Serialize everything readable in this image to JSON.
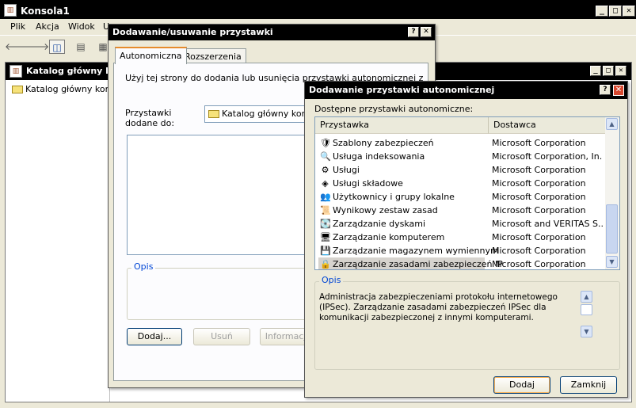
{
  "mmc": {
    "title": "Konsola1",
    "menu": [
      "Plik",
      "Akcja",
      "Widok",
      "U"
    ],
    "child_title": "Katalog główny kor",
    "tree_root": "Katalog główny kons"
  },
  "dialog1": {
    "title": "Dodawanie/usuwanie przystawki",
    "tabs": [
      "Autonomiczna",
      "Rozszerzenia"
    ],
    "intro": "Użyj tej strony do dodania lub usunięcia przystawki autonomicznej z konsoli.",
    "added_to_label": "Przystawki dodane do:",
    "added_to_value": "Katalog główny konso",
    "description_label": "Opis",
    "buttons": {
      "add": "Dodaj...",
      "remove": "Usuń",
      "about": "Informacje"
    }
  },
  "dialog2": {
    "title": "Dodawanie przystawki autonomicznej",
    "list_label": "Dostępne przystawki autonomiczne:",
    "columns": {
      "snapin": "Przystawka",
      "vendor": "Dostawca"
    },
    "rows": [
      {
        "name": "Szablony zabezpieczeń",
        "vendor": "Microsoft Corporation",
        "icon": "security-template-icon",
        "glyph": "🛡",
        "selected": false
      },
      {
        "name": "Usługa indeksowania",
        "vendor": "Microsoft Corporation, In...",
        "icon": "indexing-icon",
        "glyph": "🔍",
        "selected": false
      },
      {
        "name": "Usługi",
        "vendor": "Microsoft Corporation",
        "icon": "services-icon",
        "glyph": "⚙",
        "selected": false
      },
      {
        "name": "Usługi składowe",
        "vendor": "Microsoft Corporation",
        "icon": "components-icon",
        "glyph": "◈",
        "selected": false
      },
      {
        "name": "Użytkownicy i grupy lokalne",
        "vendor": "Microsoft Corporation",
        "icon": "users-icon",
        "glyph": "👥",
        "selected": false
      },
      {
        "name": "Wynikowy zestaw zasad",
        "vendor": "Microsoft Corporation",
        "icon": "rsop-icon",
        "glyph": "📜",
        "selected": false
      },
      {
        "name": "Zarządzanie dyskami",
        "vendor": "Microsoft and VERITAS S...",
        "icon": "disk-icon",
        "glyph": "💽",
        "selected": false
      },
      {
        "name": "Zarządzanie komputerem",
        "vendor": "Microsoft Corporation",
        "icon": "computer-icon",
        "glyph": "🖥",
        "selected": false
      },
      {
        "name": "Zarządzanie magazynem wymiennym",
        "vendor": "Microsoft Corporation",
        "icon": "removable-storage-icon",
        "glyph": "💾",
        "selected": false
      },
      {
        "name": "Zarządzanie zasadami zabezpieczeń IP",
        "vendor": "Microsoft Corporation",
        "icon": "ip-security-icon",
        "glyph": "🔒",
        "selected": true
      }
    ],
    "description_label": "Opis",
    "description_text": "Administracja zabezpieczeniami protokołu internetowego (IPSec). Zarządzanie zasadami zabezpieczeń IPSec dla komunikacji zabezpieczonej z innymi komputerami.",
    "buttons": {
      "add": "Dodaj",
      "close": "Zamknij"
    }
  }
}
